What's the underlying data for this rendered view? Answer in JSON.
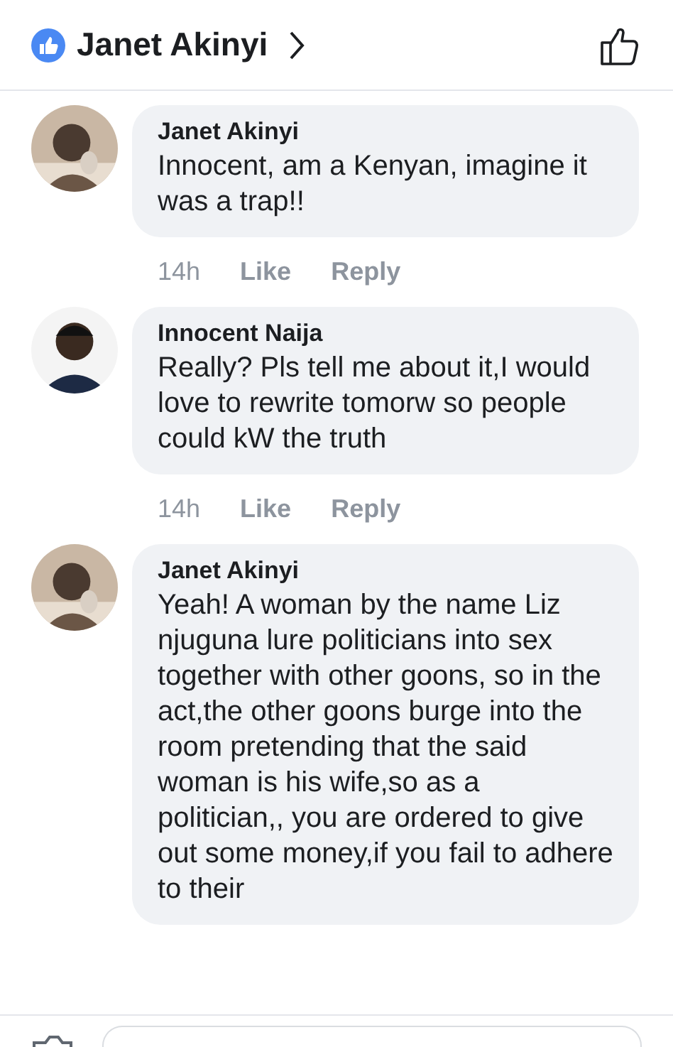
{
  "header": {
    "title": "Janet Akinyi"
  },
  "comments": [
    {
      "author": "Janet Akinyi",
      "text": "Innocent, am a Kenyan, imagine it was a trap!!",
      "time": "14h",
      "actions": [
        "Like",
        "Reply"
      ]
    },
    {
      "author": "Innocent Naija",
      "text": "Really? Pls tell me about it,I would love to rewrite tomorw so people could kW the truth",
      "time": "14h",
      "actions": [
        "Like",
        "Reply"
      ]
    },
    {
      "author": "Janet Akinyi",
      "text": "Yeah! A woman by the name Liz njuguna lure politicians into sex together with other goons, so in the act,the other goons burge into the room pretending that the said woman is his wife,so as a politician,, you are ordered to give out some money,if you fail to adhere to their"
    }
  ]
}
